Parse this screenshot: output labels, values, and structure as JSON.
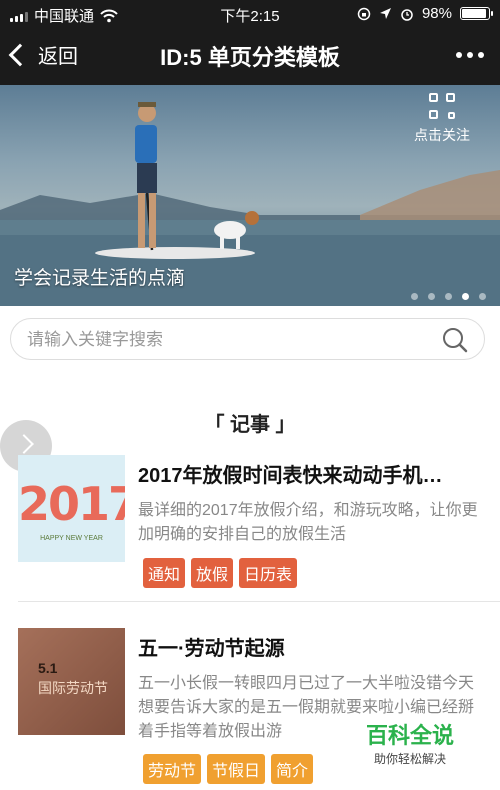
{
  "status_bar": {
    "carrier": "中国联通",
    "time": "下午2:15",
    "battery": "98%",
    "battery_level": 0.98
  },
  "nav": {
    "back_label": "返回",
    "title": "ID:5 单页分类模板"
  },
  "banner": {
    "caption": "学会记录生活的点滴",
    "qr_label": "点击关注",
    "slide_count": 5,
    "active_slide": 4
  },
  "search": {
    "placeholder": "请输入关键字搜索"
  },
  "section": {
    "title": "「 记事 」"
  },
  "articles": [
    {
      "title": "2017年放假时间表快来动动手机…",
      "desc": "最详细的2017年放假介绍，和游玩攻略，让你更加明确的安排自己的放假生活",
      "tags": [
        "通知",
        "放假",
        "日历表"
      ],
      "thumb_text": "2017",
      "thumb_sub": "HAPPY NEW YEAR"
    },
    {
      "title": "五一·劳动节起源",
      "desc": "五一小长假一转眼四月已过了一大半啦没错今天想要告诉大家的是五一假期就要来啦小编已经掰着手指等着放假出游",
      "tags": [
        "劳动节",
        "节假日",
        "简介"
      ],
      "thumb_text": "5.1",
      "thumb_sub": "国际劳动节"
    }
  ],
  "watermark": {
    "main": "百科全说",
    "sub": "助你轻松解决"
  },
  "colors": {
    "tag_red": "#e2613e",
    "tag_orange": "#f0a030",
    "topbar": "#1b1b1b",
    "watermark_green": "#2bb24c"
  }
}
